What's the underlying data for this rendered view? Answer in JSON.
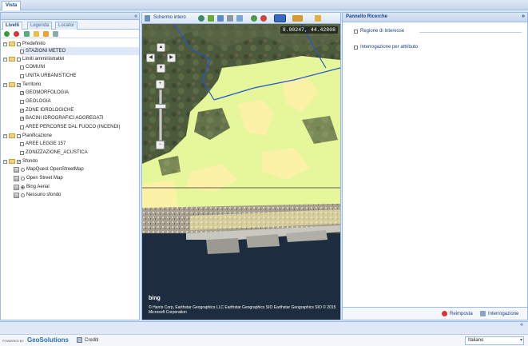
{
  "top_tab": "Vista",
  "left_panel": {
    "collapse_icon": "double-chevron-left-icon",
    "tabs": [
      {
        "label": "Livelli",
        "active": true
      },
      {
        "label": "Legenda",
        "active": false
      },
      {
        "label": "Locator",
        "active": false
      }
    ],
    "tree": [
      {
        "label": "Predefinito",
        "type": "group",
        "checked": false
      },
      {
        "label": "STAZIONI METEO",
        "type": "layer",
        "checked": false,
        "selected": true
      },
      {
        "label": "Limiti amministrativi",
        "type": "group",
        "checked": false
      },
      {
        "label": "COMUNI",
        "type": "layer",
        "checked": false
      },
      {
        "label": "UNITA URBANISTICHE",
        "type": "layer",
        "checked": false
      },
      {
        "label": "Territorio",
        "type": "group",
        "checked": true
      },
      {
        "label": "GEOMORFOLOGIA",
        "type": "layer",
        "checked": true
      },
      {
        "label": "GEOLOGIA",
        "type": "layer",
        "checked": false
      },
      {
        "label": "ZONE IDROLOGICHE",
        "type": "layer",
        "checked": true
      },
      {
        "label": "BACINI IDROGRAFICI AGGREGATI",
        "type": "layer",
        "checked": true
      },
      {
        "label": "AREE PERCORSE DAL FUOCO (INCENDI)",
        "type": "layer",
        "checked": false
      },
      {
        "label": "Pianificazione",
        "type": "group",
        "checked": false
      },
      {
        "label": "AREE LEGGE 157",
        "type": "layer",
        "checked": false
      },
      {
        "label": "ZONIZZAZIONE_ACUSTICA",
        "type": "layer",
        "checked": false
      },
      {
        "label": "Sfondo",
        "type": "group",
        "checked": true
      },
      {
        "label": "MapQuest OpenStreetMap",
        "type": "radio",
        "checked": false
      },
      {
        "label": "Open Street Map",
        "type": "radio",
        "checked": false
      },
      {
        "label": "Bing Aerial",
        "type": "radio",
        "checked": true
      },
      {
        "label": "Nessuno sfondo",
        "type": "radio",
        "checked": false
      }
    ]
  },
  "map": {
    "toolbar_label": "Schermo intero",
    "coordinates": "8.90247, 44.42808",
    "bing_logo": "bing",
    "attribution": "© Harris Corp, Earthstar Geographics LLC Earthstar Geographics SIO Earthstar Geographics SIO © 2015 Microsoft Corporation"
  },
  "right_panel": {
    "title": "Pannello Ricerche",
    "expand_icon": "double-chevron-right-icon",
    "items": [
      "Regione di Interesse",
      "Interrogazione per attributo"
    ],
    "footer": {
      "reset_label": "Reimposta",
      "query_label": "Interrogazione"
    }
  },
  "status": {
    "powered_by": "POWERED BY",
    "brand": "GeoSolutions",
    "credits": "Crediti",
    "language": "Italiano"
  },
  "colors": {
    "panel_border": "#99bbe8",
    "header_text": "#15428b",
    "zone_light_green": "#e5f79a",
    "zone_yellow": "#fbf2a8",
    "boundary_blue": "#2255cc"
  }
}
